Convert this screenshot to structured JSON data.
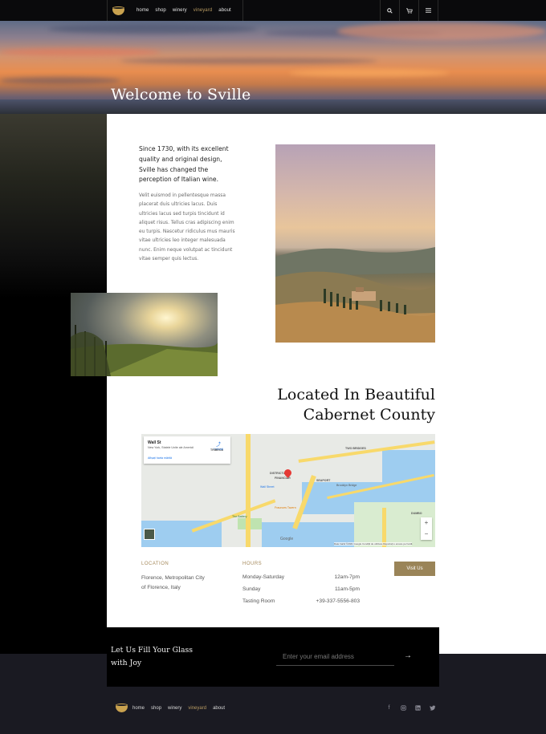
{
  "nav": {
    "links": [
      {
        "label": "home",
        "active": false
      },
      {
        "label": "shop",
        "active": false
      },
      {
        "label": "winery",
        "active": false
      },
      {
        "label": "vineyard",
        "active": true
      },
      {
        "label": "about",
        "active": false
      }
    ],
    "icons": [
      "search-icon",
      "cart-icon",
      "menu-icon"
    ]
  },
  "hero": {
    "title": "Welcome to Sville"
  },
  "intro": {
    "lead": "Since 1730, with its excellent quality and original design, Sville has changed the perception of Italian wine.",
    "body": "Velit euismod in pellentesque massa placerat duis ultricies lacus. Duis ultricies lacus sed turpis tincidunt id aliquet risus. Tellus cras adipiscing enim eu turpis. Nascetur ridiculus mus mauris vitae ultricies leo integer malesuada nunc. Enim neque volutpat ac tincidunt vitae semper quis lectus."
  },
  "located": {
    "line1": "Located In Beautiful",
    "line2": "Cabernet County"
  },
  "map": {
    "place_name": "Wall St",
    "place_address": "New York, Statele Unite ale Americii",
    "larger_map": "Afișați harta mărită",
    "directions": "Indicații",
    "logo": "Google",
    "credit": "Date hartă ©2021 Google   Condiții de utilizare   Raportați o eroare pe hartă",
    "labels": {
      "tribeca": "TRIBECA",
      "district": "FINANCIAR",
      "district_top": "DISTRICTUL",
      "seaport": "SEAPORT",
      "two_bridges": "TWO BRIDGES",
      "dumbo": "DUMBO",
      "wall_street": "Wall Street",
      "fraunces": "Fraunces Tavern",
      "battery": "The Battery",
      "brooklyn_bridge": "Brooklyn Bridge"
    }
  },
  "location": {
    "heading": "LOCATION",
    "line1": "Florence, Metropolitan City",
    "line2": "of Florence, Italy"
  },
  "hours": {
    "heading": "HOURS",
    "rows": [
      {
        "label": "Monday-Saturday",
        "value": "12am-7pm"
      },
      {
        "label": "Sunday",
        "value": "11am-5pm"
      },
      {
        "label": "Tasting Room",
        "value": "+39-337-5556-803"
      }
    ]
  },
  "visit_button": "Visit Us",
  "newsletter": {
    "title_line1": "Let Us Fill Your Glass",
    "title_line2": "with Joy",
    "placeholder": "Enter your email address"
  },
  "footer": {
    "links": [
      {
        "label": "home",
        "active": false
      },
      {
        "label": "shop",
        "active": false
      },
      {
        "label": "winery",
        "active": false
      },
      {
        "label": "vineyard",
        "active": true
      },
      {
        "label": "about",
        "active": false
      }
    ],
    "social": [
      "facebook-icon",
      "instagram-icon",
      "linkedin-icon",
      "twitter-icon"
    ]
  },
  "colors": {
    "accent_gold": "#9a8458",
    "nav_active": "#b79a62",
    "footer_bg": "#1a1a22"
  }
}
